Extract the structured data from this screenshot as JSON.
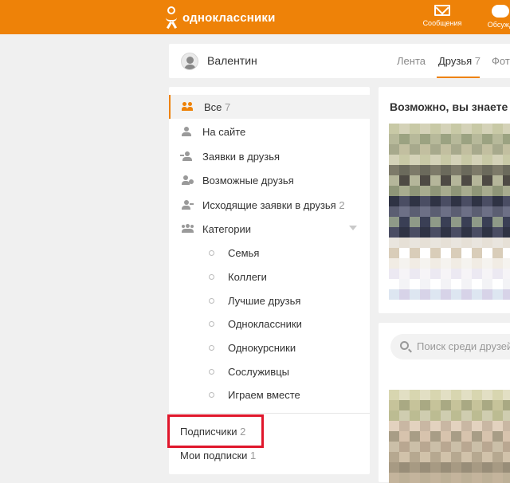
{
  "topbar": {
    "logo_text": "одноклассники",
    "nav": [
      {
        "label": "Сообщения",
        "icon": "envelope-icon"
      },
      {
        "label": "Обсужд",
        "icon": "chat-bubble-icon"
      }
    ],
    "color": "#ee8208"
  },
  "profile": {
    "name": "Валентин",
    "tabs": [
      {
        "label": "Лента",
        "count": ""
      },
      {
        "label": "Друзья",
        "count": "7"
      },
      {
        "label": "Фот",
        "count": ""
      }
    ]
  },
  "sidebar": {
    "items": [
      {
        "label": "Все",
        "count": "7",
        "icon": "friends-icon"
      },
      {
        "label": "На сайте",
        "count": "",
        "icon": "user-online-icon"
      },
      {
        "label": "Заявки в друзья",
        "count": "",
        "icon": "friend-request-icon"
      },
      {
        "label": "Возможные друзья",
        "count": "",
        "icon": "possible-friends-icon"
      },
      {
        "label": "Исходящие заявки в друзья",
        "count": "2",
        "icon": "outgoing-request-icon"
      },
      {
        "label": "Категории",
        "count": "",
        "icon": "categories-icon"
      }
    ],
    "categories": [
      "Семья",
      "Коллеги",
      "Лучшие друзья",
      "Одноклассники",
      "Однокурсники",
      "Сослуживцы",
      "Играем вместе"
    ],
    "subscribers_label": "Подписчики",
    "subscribers_count": "2",
    "subscriptions_label": "Мои подписки",
    "subscriptions_count": "1"
  },
  "suggestions": {
    "title": "Возможно, вы знаете"
  },
  "search": {
    "placeholder": "Поиск среди друзей"
  }
}
